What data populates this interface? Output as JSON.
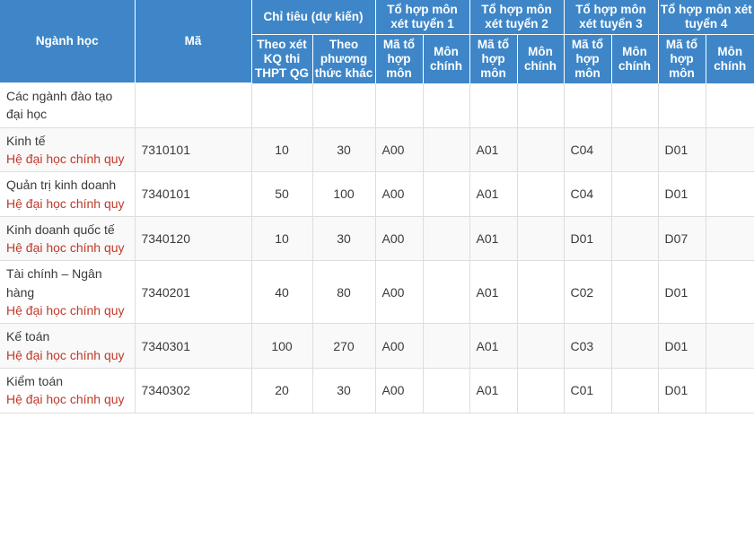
{
  "table": {
    "header": {
      "col_major": "Ngành học",
      "col_code": "Mã",
      "group_quota": "Chỉ tiêu (dự kiến)",
      "quota_sub_1": "Theo xét KQ thi THPT QG",
      "quota_sub_2": "Theo phương thức khác",
      "groups": [
        {
          "title": "Tổ hợp môn xét tuyển 1",
          "sub_code": "Mã tổ hợp môn",
          "sub_main": "Môn chính"
        },
        {
          "title": "Tổ hợp môn xét tuyển 2",
          "sub_code": "Mã tổ hợp môn",
          "sub_main": "Môn chính"
        },
        {
          "title": "Tổ hợp môn xét tuyển 3",
          "sub_code": "Mã tổ hợp môn",
          "sub_main": "Môn chính"
        },
        {
          "title": "Tổ hợp môn xét tuyển 4",
          "sub_code": "Mã tổ hợp môn",
          "sub_main": "Môn chính"
        }
      ]
    },
    "rows": [
      {
        "major": "Các ngành đào tạo đại học",
        "sub": "",
        "code": "",
        "quota_thpt": "",
        "quota_other": "",
        "c1_code": "",
        "c1_main": "",
        "c2_code": "",
        "c2_main": "",
        "c3_code": "",
        "c3_main": "",
        "c4_code": "",
        "c4_main": ""
      },
      {
        "major": "Kinh tế",
        "sub": "Hệ đại học chính quy",
        "code": "7310101",
        "quota_thpt": "10",
        "quota_other": "30",
        "c1_code": "A00",
        "c1_main": "",
        "c2_code": "A01",
        "c2_main": "",
        "c3_code": "C04",
        "c3_main": "",
        "c4_code": "D01",
        "c4_main": ""
      },
      {
        "major": "Quản trị kinh doanh",
        "sub": "Hệ đại học chính quy",
        "code": "7340101",
        "quota_thpt": "50",
        "quota_other": "100",
        "c1_code": "A00",
        "c1_main": "",
        "c2_code": "A01",
        "c2_main": "",
        "c3_code": "C04",
        "c3_main": "",
        "c4_code": "D01",
        "c4_main": ""
      },
      {
        "major": "Kinh doanh quốc tế",
        "sub": "Hệ đại học chính quy",
        "code": "7340120",
        "quota_thpt": "10",
        "quota_other": "30",
        "c1_code": "A00",
        "c1_main": "",
        "c2_code": "A01",
        "c2_main": "",
        "c3_code": "D01",
        "c3_main": "",
        "c4_code": "D07",
        "c4_main": ""
      },
      {
        "major": "Tài chính – Ngân hàng",
        "sub": "Hệ đại học chính quy",
        "code": "7340201",
        "quota_thpt": "40",
        "quota_other": "80",
        "c1_code": "A00",
        "c1_main": "",
        "c2_code": "A01",
        "c2_main": "",
        "c3_code": "C02",
        "c3_main": "",
        "c4_code": "D01",
        "c4_main": ""
      },
      {
        "major": "Kế toán",
        "sub": "Hệ đại học chính quy",
        "code": "7340301",
        "quota_thpt": "100",
        "quota_other": "270",
        "c1_code": "A00",
        "c1_main": "",
        "c2_code": "A01",
        "c2_main": "",
        "c3_code": "C03",
        "c3_main": "",
        "c4_code": "D01",
        "c4_main": ""
      },
      {
        "major": "Kiểm toán",
        "sub": "Hệ đại học chính quy",
        "code": "7340302",
        "quota_thpt": "20",
        "quota_other": "30",
        "c1_code": "A00",
        "c1_main": "",
        "c2_code": "A01",
        "c2_main": "",
        "c3_code": "C01",
        "c3_main": "",
        "c4_code": "D01",
        "c4_main": ""
      }
    ]
  },
  "colors": {
    "header_bg": "#3e86c8",
    "header_text": "#ffffff",
    "sub_text": "#c0392b",
    "body_text": "#3a3a3a",
    "row_alt_bg": "#f9f9f9",
    "grid_line": "#dddddd"
  }
}
